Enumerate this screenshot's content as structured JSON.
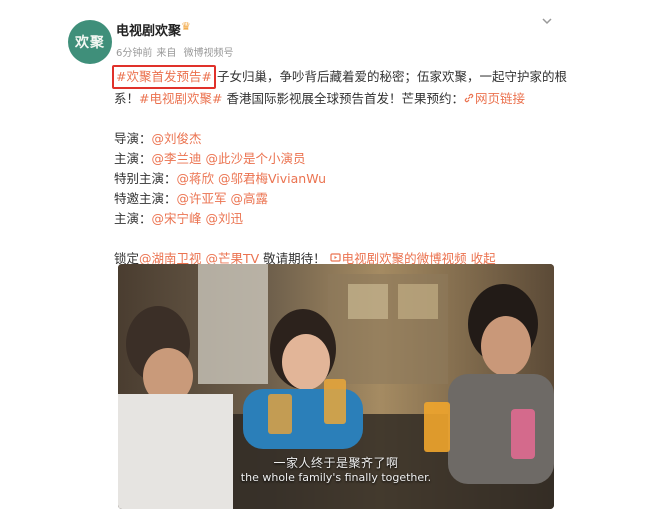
{
  "post": {
    "author": "电视剧欢聚",
    "avatar_text": "欢聚",
    "time": "6分钟前",
    "source_prefix": "来自",
    "source": "微博视频号",
    "hashtag": "#欢聚首发预告#",
    "text1": "子女归巢，争吵背后藏着爱的秘密；伍家欢聚，一起守护家的根",
    "text2_prefix": "系！",
    "hashtag2": "#电视剧欢聚#",
    "text2_mid": " 香港国际影视展全球预告首发！芒果预约：",
    "web_link": "网页链接",
    "credits": [
      {
        "label": "导演：",
        "names": [
          "@刘俊杰"
        ]
      },
      {
        "label": "主演：",
        "names": [
          "@李兰迪",
          "@此沙是个小演员"
        ]
      },
      {
        "label": "特别主演：",
        "names": [
          "@蒋欣",
          "@邬君梅VivianWu"
        ]
      },
      {
        "label": "特邀主演：",
        "names": [
          "@许亚军",
          "@高露"
        ]
      },
      {
        "label": "主演：",
        "names": [
          "@宋宁峰",
          "@刘迅"
        ]
      }
    ],
    "lock_prefix": "锁定",
    "lock_mention1": "@湖南卫视",
    "lock_mention2": "@芒果TV",
    "lock_text": " 敬请期待！",
    "video_link": "电视剧欢聚的微博视频",
    "collapse": "收起"
  },
  "video": {
    "subtitle_cn": "一家人终于是聚齐了啊",
    "subtitle_en": "the whole family's finally together."
  },
  "icons": {
    "crown": "crown-icon",
    "chevron": "chevron-down-icon",
    "link": "link-icon",
    "video": "video-icon"
  },
  "colors": {
    "link": "#eb7350",
    "highlight_box": "#e0312a",
    "avatar_bg": "#3f8f7a"
  }
}
